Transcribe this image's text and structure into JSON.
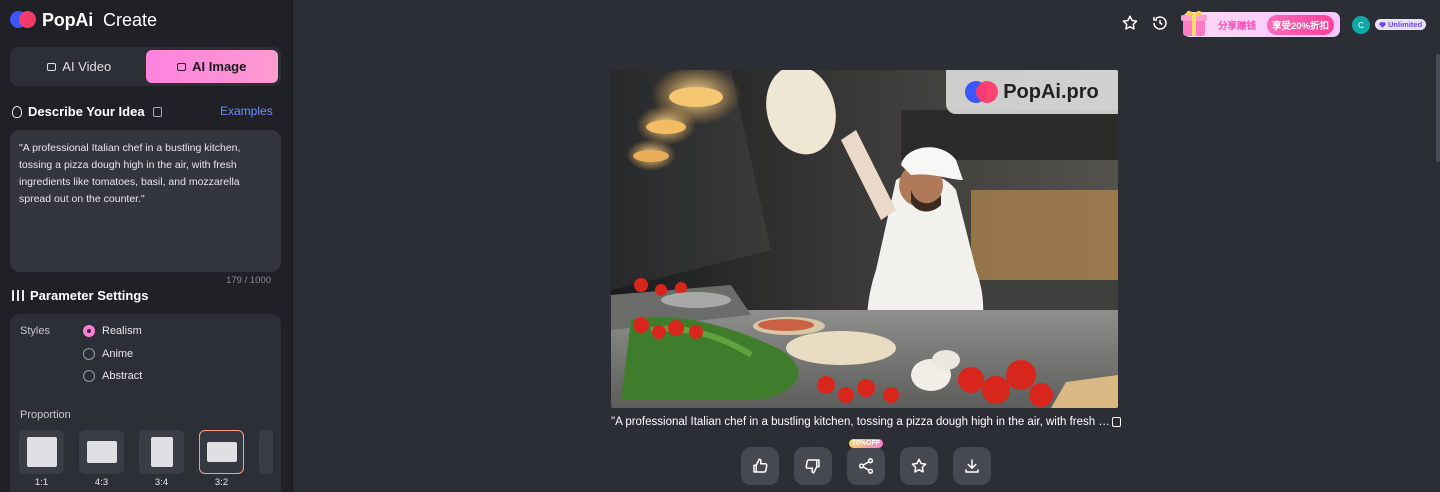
{
  "brand": {
    "name": "PopAi",
    "section": "Create"
  },
  "modes": [
    {
      "label": "AI Video",
      "icon": "video-icon",
      "active": false
    },
    {
      "label": "AI Image",
      "icon": "image-icon",
      "active": true
    }
  ],
  "idea": {
    "title": "Describe Your Idea",
    "examples_label": "Examples",
    "prompt": "\"A professional Italian chef in a bustling kitchen, tossing a pizza dough high in the air, with fresh ingredients like tomatoes, basil, and mozzarella spread out on the counter.\"",
    "counter": "179 / 1000"
  },
  "params": {
    "title": "Parameter Settings",
    "styles_label": "Styles",
    "styles": [
      {
        "label": "Realism",
        "selected": true
      },
      {
        "label": "Anime",
        "selected": false
      },
      {
        "label": "Abstract",
        "selected": false
      }
    ],
    "proportion_label": "Proportion",
    "ratios": [
      {
        "label": "1:1",
        "selected": false
      },
      {
        "label": "4:3",
        "selected": false
      },
      {
        "label": "3:4",
        "selected": false
      },
      {
        "label": "3:2",
        "selected": true
      }
    ]
  },
  "topbar": {
    "promo_text": "分享赚钱",
    "promo_button": "享受20%折扣",
    "avatar_initial": "C",
    "plan": "Unlimited"
  },
  "result": {
    "watermark": "PopAi.pro",
    "caption": "\"A professional Italian chef in a bustling kitchen, tossing a pizza dough high in the air, with fresh ingredients like tomatoes, basil, and mozzarella spread out on the counter.\"",
    "share_badge": "20%OFF"
  },
  "colors": {
    "accent_pink": "#ff82e0",
    "link_blue": "#6f8dff",
    "bg": "#2b2e34",
    "sidebar": "#1f2126"
  }
}
